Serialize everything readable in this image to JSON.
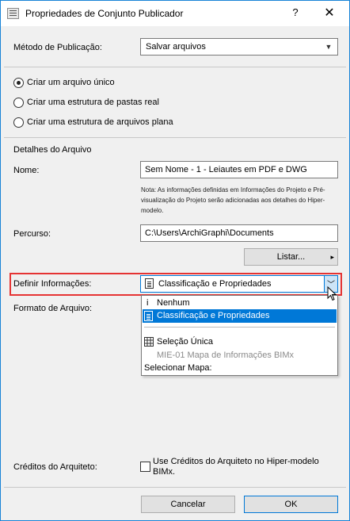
{
  "window": {
    "title": "Propriedades de Conjunto Publicador",
    "help_label": "?",
    "close_label": "✕"
  },
  "publish_method": {
    "label": "Método de Publicação:",
    "value": "Salvar arquivos"
  },
  "structure_options": [
    {
      "label": "Criar um arquivo único",
      "selected": true
    },
    {
      "label": "Criar uma estrutura de pastas real",
      "selected": false
    },
    {
      "label": "Criar uma estrutura de arquivos plana",
      "selected": false
    }
  ],
  "file_details": {
    "heading": "Detalhes do Arquivo",
    "name_label": "Nome:",
    "name_value": "Sem Nome - 1 - Leiautes em PDF e DWG",
    "note": "Nota: As informações definidas em Informações do Projeto e Pré-visualização do Projeto serão adicionadas aos detalhes do Hiper-modelo.",
    "path_label": "Percurso:",
    "path_value": "C:\\Users\\ArchiGraphi\\Documents",
    "browse_label": "Listar...",
    "browse_arrow": "▸"
  },
  "define_info": {
    "label": "Definir Informações:",
    "value": "Classificação e Propriedades",
    "chevron": "﹀"
  },
  "file_format": {
    "label": "Formato de Arquivo:"
  },
  "dropdown": {
    "items": [
      {
        "label": "Nenhum",
        "glyph": "i"
      },
      {
        "label": "Classificação e Propriedades"
      },
      {
        "label": "Seleção Única"
      },
      {
        "label": "MIE-01 Mapa de Informações BIMx"
      },
      {
        "label": "Selecionar Mapa:"
      }
    ]
  },
  "architect_credits": {
    "label": "Créditos do Arquiteto:",
    "checkbox_label_line1": "Use Créditos do Arquiteto no Hiper-modelo",
    "checkbox_label_line2": "BIMx.",
    "checked": false
  },
  "footer": {
    "cancel_label": "Cancelar",
    "ok_label": "OK"
  },
  "colors": {
    "accent": "#0078d7",
    "highlight": "#e53333"
  }
}
